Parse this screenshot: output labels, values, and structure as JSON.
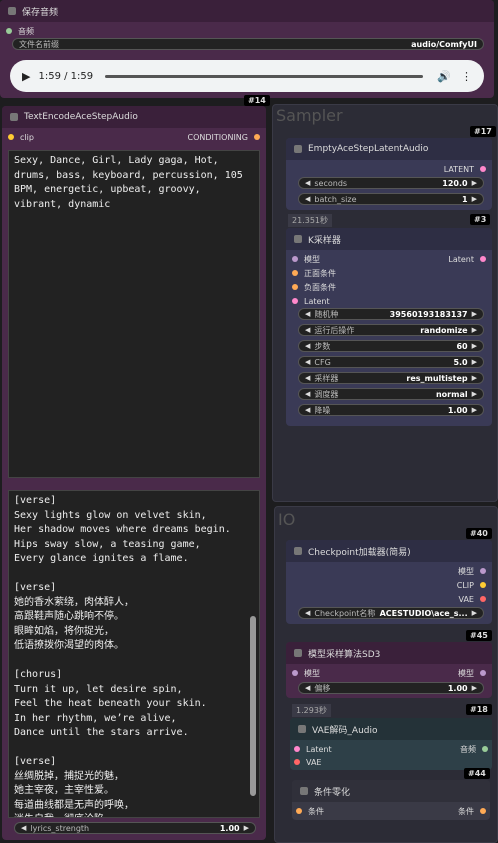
{
  "save_audio": {
    "title": "保存音频",
    "input_audio": "音频",
    "prefix_label": "文件名前缀",
    "prefix_value": "audio/ComfyUI",
    "time": "1:59 / 1:59",
    "id": "#14"
  },
  "text_encode": {
    "title": "TextEncodeAceStepAudio",
    "input_clip": "clip",
    "output": "CONDITIONING",
    "tags": "Sexy, Dance, Girl, Lady gaga, Hot,\ndrums, bass, keyboard, percussion, 105\nBPM, energetic, upbeat, groovy,\nvibrant, dynamic",
    "lyrics": "[verse]\nSexy lights glow on velvet skin,\nHer shadow moves where dreams begin.\nHips sway slow, a teasing game,\nEvery glance ignites a flame.\n\n[verse]\n她的香水萦绕，肉体醉人，\n高跟鞋声随心跳响不停。\n眼眸如焰，将你捉光，\n低语撩拨你渴望的肉体。\n\n[chorus]\nTurn it up, let desire spin,\nFeel the heat beneath your skin.\nIn her rhythm, we’re alive,\nDance until the stars arrive.\n\n[verse]\n丝绸脱掉，捕捉光的魅，\n她主宰夜，主宰性爱。\n每道曲线都是无声的呼唤，\n迷失自我，彻底沦陷。",
    "lyrics_strength_label": "lyrics_strength",
    "lyrics_strength_value": "1.00"
  },
  "sampler_group": {
    "title": "Sampler"
  },
  "empty_latent": {
    "title": "EmptyAceStepLatentAudio",
    "output": "LATENT",
    "seconds_label": "seconds",
    "seconds_value": "120.0",
    "batch_label": "batch_size",
    "batch_value": "1",
    "id": "#17",
    "time": "21.351秒",
    "id2": "#3"
  },
  "ksampler": {
    "title": "K采样器",
    "in_model": "模型",
    "in_pos": "正面条件",
    "in_neg": "负面条件",
    "in_latent": "Latent",
    "output": "Latent",
    "widgets": [
      {
        "label": "随机种",
        "value": "395601931831​37"
      },
      {
        "label": "运行后操作",
        "value": "randomize"
      },
      {
        "label": "步数",
        "value": "60"
      },
      {
        "label": "CFG",
        "value": "5.0"
      },
      {
        "label": "采样器",
        "value": "res_multistep"
      },
      {
        "label": "调度器",
        "value": "normal"
      },
      {
        "label": "降噪",
        "value": "1.00"
      }
    ]
  },
  "io_group": {
    "title": "IO"
  },
  "checkpoint": {
    "title": "Checkpoint加载器(简易)",
    "out_model": "模型",
    "out_clip": "CLIP",
    "out_vae": "VAE",
    "ckpt_label": "Checkpoint名称",
    "ckpt_value": "ACESTUDIO\\ace_s...",
    "id": "#40",
    "id2": "#45"
  },
  "model_sampling": {
    "title": "模型采样算法SD3",
    "in_model": "模型",
    "out_model": "模型",
    "shift_label": "偏移",
    "shift_value": "1.00",
    "time": "1.293秒",
    "id": "#18"
  },
  "vae_decode": {
    "title": "VAE解码_Audio",
    "in_latent": "Latent",
    "in_vae": "VAE",
    "output": "音频",
    "id": "#44"
  },
  "cond_zero": {
    "title": "条件零化",
    "input": "条件",
    "output": "条件"
  }
}
